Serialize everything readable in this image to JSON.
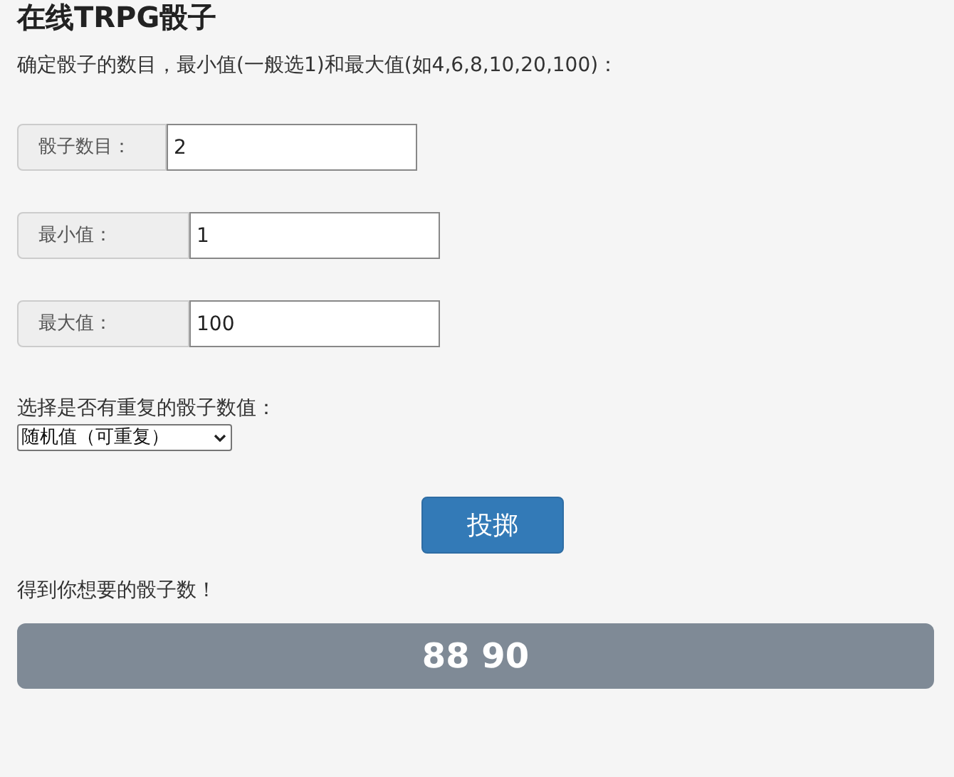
{
  "title": "在线TRPG骰子",
  "intro": "确定骰子的数目，最小值(一般选1)和最大值(如4,6,8,10,20,100)：",
  "fields": [
    {
      "label": "骰子数目：",
      "value": "2"
    },
    {
      "label": "最小值：",
      "value": "1"
    },
    {
      "label": "最大值：",
      "value": "100"
    }
  ],
  "repeat_label": "选择是否有重复的骰子数值：",
  "repeat_select": {
    "value": "随机值（可重复）"
  },
  "roll_button": "投掷",
  "result_label": "得到你想要的骰子数！",
  "result": "88 90"
}
